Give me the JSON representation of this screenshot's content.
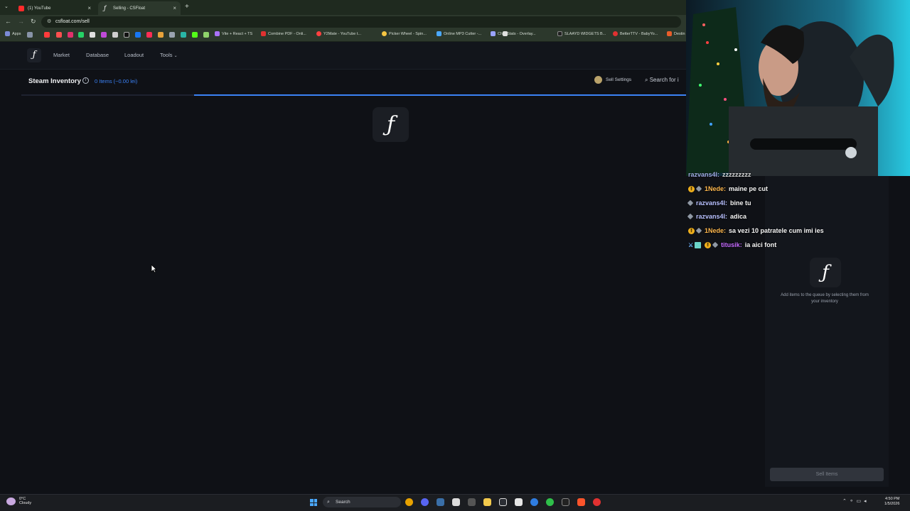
{
  "browser": {
    "tabs": [
      {
        "title": "(1) YouTube",
        "active": false
      },
      {
        "title": "Selling - CSFloat",
        "active": true
      }
    ],
    "url": "csfloat.com/sell",
    "bookmarks": [
      "Apps",
      "Vite + React + TS",
      "Combine PDF - Onli...",
      "Y2Mate - YouTube t...",
      "Picker Wheel - Spin...",
      "Online MP3 Cutter -...",
      "Chat Stats - Overlay...",
      "SLAAYD WIDGETS B...",
      "BetterTTV - BabyYo...",
      "Destin"
    ]
  },
  "site": {
    "nav": [
      "Market",
      "Database",
      "Loadout",
      "Tools"
    ],
    "logo_glyph": "ƒ",
    "inventory": {
      "title": "Steam Inventory",
      "count": "0 Items (~0.00 lei)",
      "sell_settings": "Sell Settings",
      "search_placeholder": "Search for i"
    },
    "progress_fraction": 0.74,
    "queue": {
      "hint": "Add items to the queue by selecting them from your inventory",
      "sell_button": "Sell Items"
    }
  },
  "chat": {
    "messages": [
      {
        "user": "razvans4l",
        "text": "zzzzzzzzz",
        "color": "#b8c0ff"
      },
      {
        "user": "1Nede",
        "text": "maine pe cut",
        "color": "#ffb84d"
      },
      {
        "user": "razvans4l",
        "text": "bine tu",
        "color": "#b8c0ff"
      },
      {
        "user": "razvans4l",
        "text": "adica",
        "color": "#b8c0ff"
      },
      {
        "user": "1Nede",
        "text": "sa vezi 10 patratele cum imi ies",
        "color": "#ffb84d"
      },
      {
        "user": "titusik",
        "text": "ia aici font",
        "color": "#c56bff"
      }
    ]
  },
  "taskbar": {
    "weather_temp": "0°C",
    "weather_desc": "Cloudy",
    "search": "Search",
    "time": "4:50 PM",
    "date": "1/5/2026"
  },
  "colors": {
    "accent": "#3b82f6",
    "page_bg": "#0f1116"
  }
}
